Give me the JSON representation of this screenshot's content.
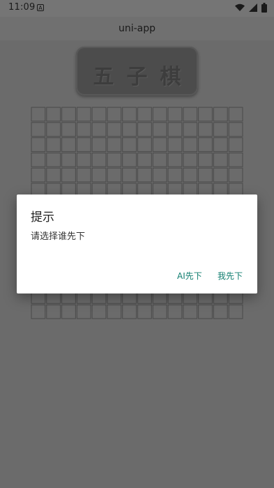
{
  "status_bar": {
    "time": "11:09",
    "icon_left": "A",
    "icons": [
      "wifi-icon",
      "signal-icon",
      "battery-icon"
    ]
  },
  "app_bar": {
    "title": "uni-app"
  },
  "logo": {
    "text": "五子棋"
  },
  "board": {
    "rows": 14,
    "cols": 14
  },
  "dialog": {
    "title": "提示",
    "message": "请选择谁先下",
    "buttons": {
      "ai_first": "AI先下",
      "me_first": "我先下"
    }
  },
  "colors": {
    "background": "#6b6b6b",
    "dialog": "#ffffff",
    "accent": "#0f7d6f"
  }
}
